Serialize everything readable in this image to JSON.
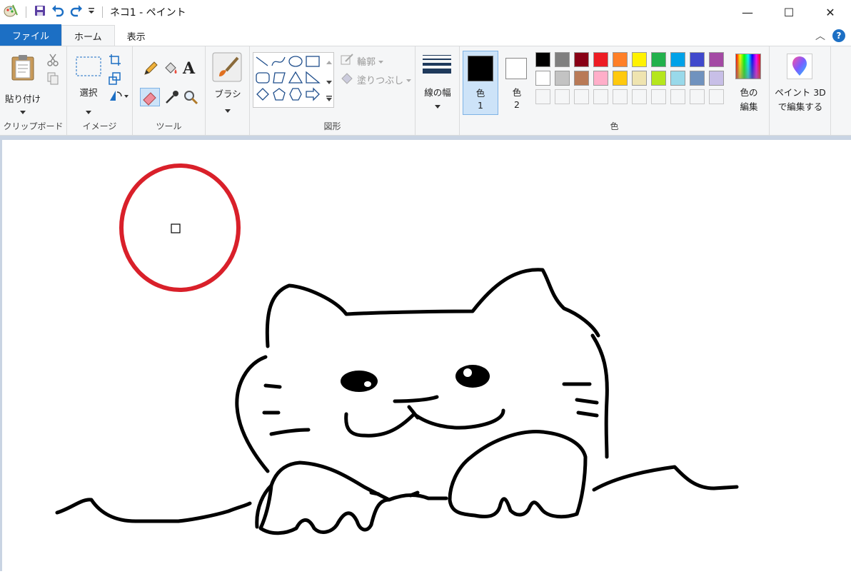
{
  "window": {
    "title": "ネコ1 - ペイント",
    "minimize_glyph": "—",
    "maximize_glyph": "☐",
    "close_glyph": "✕"
  },
  "tabs": [
    {
      "label": "ファイル"
    },
    {
      "label": "ホーム"
    },
    {
      "label": "表示"
    }
  ],
  "help_label": "?",
  "collapse_glyph": "︿",
  "ribbon": {
    "clipboard": {
      "paste_label": "貼り付け",
      "group_label": "クリップボード"
    },
    "image": {
      "select_label": "選択",
      "group_label": "イメージ"
    },
    "tools": {
      "group_label": "ツール"
    },
    "brush": {
      "label": "ブラシ"
    },
    "shapes": {
      "outline_label": "輪郭",
      "fill_label": "塗りつぶし",
      "group_label": "図形"
    },
    "size": {
      "label": "線の幅"
    },
    "color1": {
      "label_top": "色",
      "label_bottom": "1"
    },
    "color2": {
      "label_top": "色",
      "label_bottom": "2"
    },
    "colors": {
      "group_label": "色",
      "edit_label_top": "色の",
      "edit_label_bottom": "編集",
      "row1": [
        "#000000",
        "#7f7f7f",
        "#880015",
        "#ed1c24",
        "#ff7f27",
        "#fff200",
        "#22b14c",
        "#00a2e8",
        "#3f48cc",
        "#a349a4"
      ],
      "row2": [
        "#ffffff",
        "#c3c3c3",
        "#b97a57",
        "#ffaec9",
        "#ffc90e",
        "#efe4b0",
        "#b5e61d",
        "#99d9ea",
        "#7092be",
        "#c8bfe7"
      ]
    },
    "paint3d": {
      "label_top": "ペイント 3D",
      "label_bottom": "で編集する"
    }
  },
  "colors": {
    "accent": "#1c6fc4",
    "color1": "#000000",
    "color2": "#ffffff",
    "circle": "#d9202a"
  }
}
